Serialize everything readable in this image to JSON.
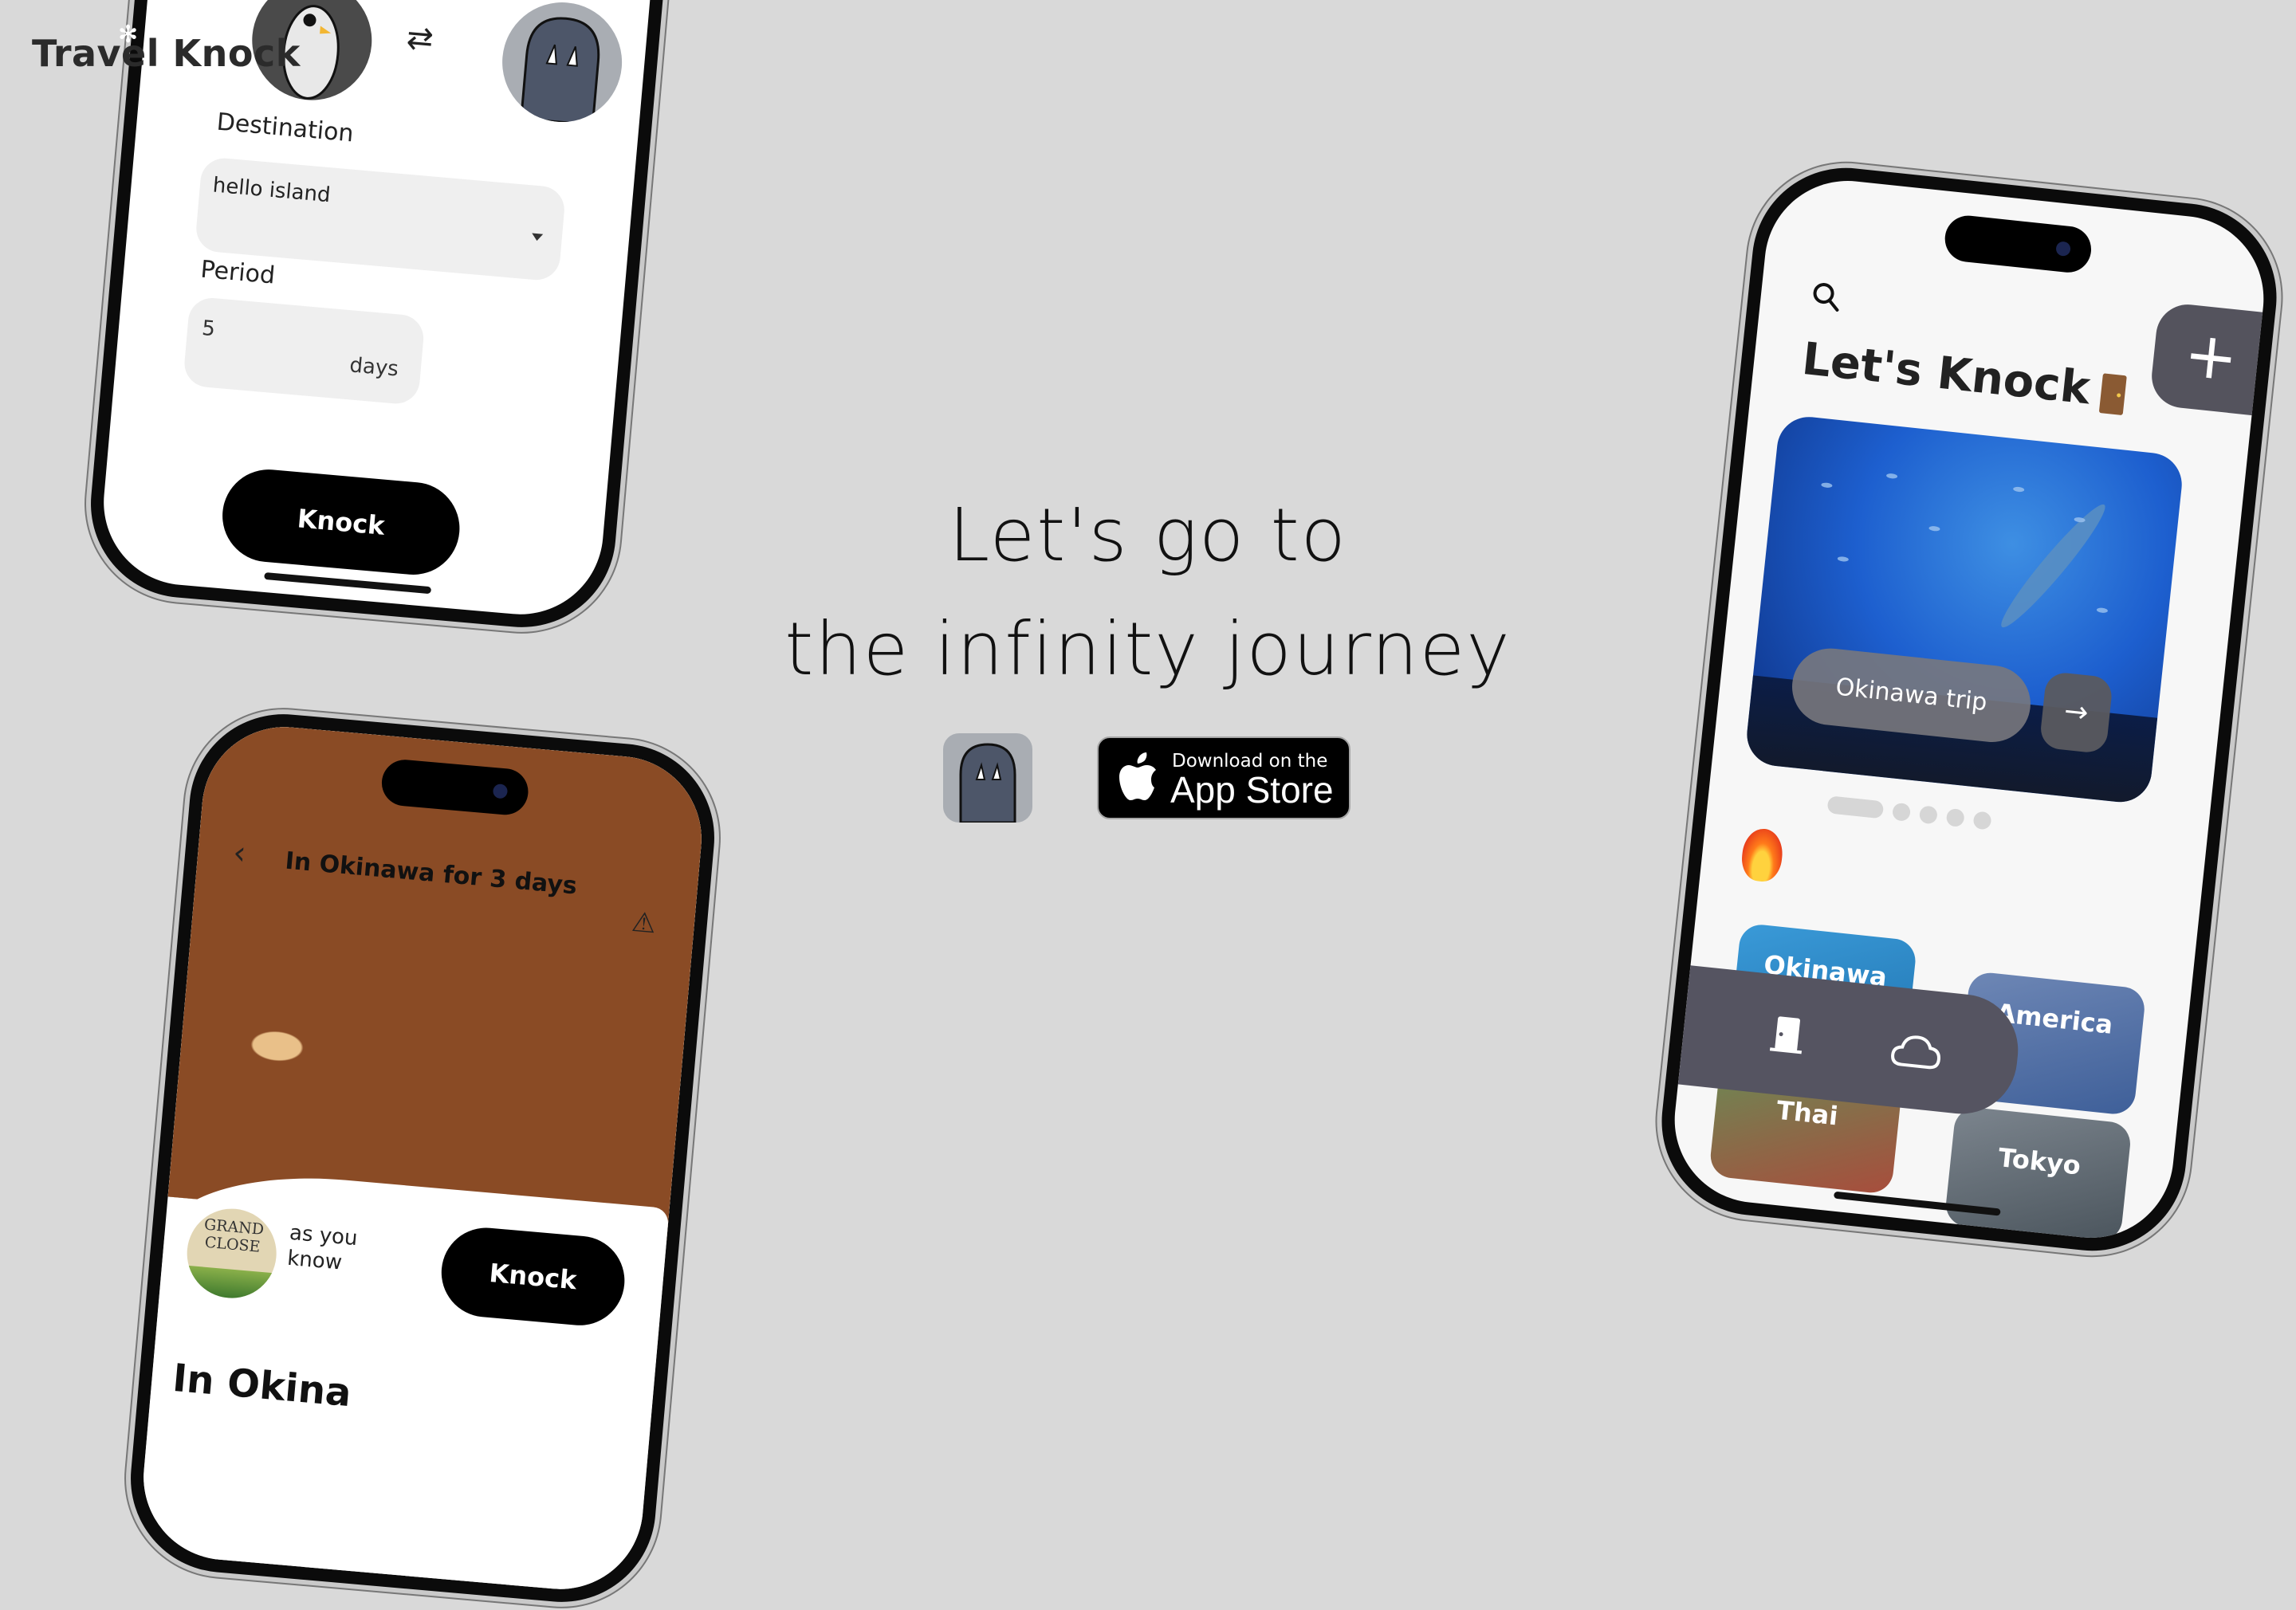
{
  "brand": {
    "name": "Travel Knock"
  },
  "hero": {
    "line1": "Let's go to",
    "line2": "the infinity journey"
  },
  "store_badge": {
    "small": "Download on the",
    "big": "App Store"
  },
  "phone_setup": {
    "destination_label": "Destination",
    "destination_value": "hello island",
    "period_label": "Period",
    "period_value": "5",
    "period_unit": "days",
    "knock_label": "Knock"
  },
  "phone_detail": {
    "title": "In Okinawa for 3 days",
    "badge_text": "GRAND CLOSE",
    "caption_line1": "as you",
    "caption_line2": "know",
    "knock_label": "Knock",
    "heading": "In Okina"
  },
  "phone_home": {
    "title": "Let's Knock",
    "fab_label": "+",
    "featured_trip": "Okinawa trip",
    "arrow": "→",
    "destinations": [
      "Okinawa",
      "America",
      "Thai",
      "Tokyo"
    ],
    "carousel_index": 1,
    "carousel_count": 5
  },
  "icons": {
    "swap": "swap-arrows-icon",
    "search": "search-icon",
    "back": "chevron-left-icon",
    "warning": "warning-icon",
    "fire": "fire-icon",
    "door": "door-icon",
    "cloud": "cloud-icon",
    "apple": "apple-icon"
  }
}
